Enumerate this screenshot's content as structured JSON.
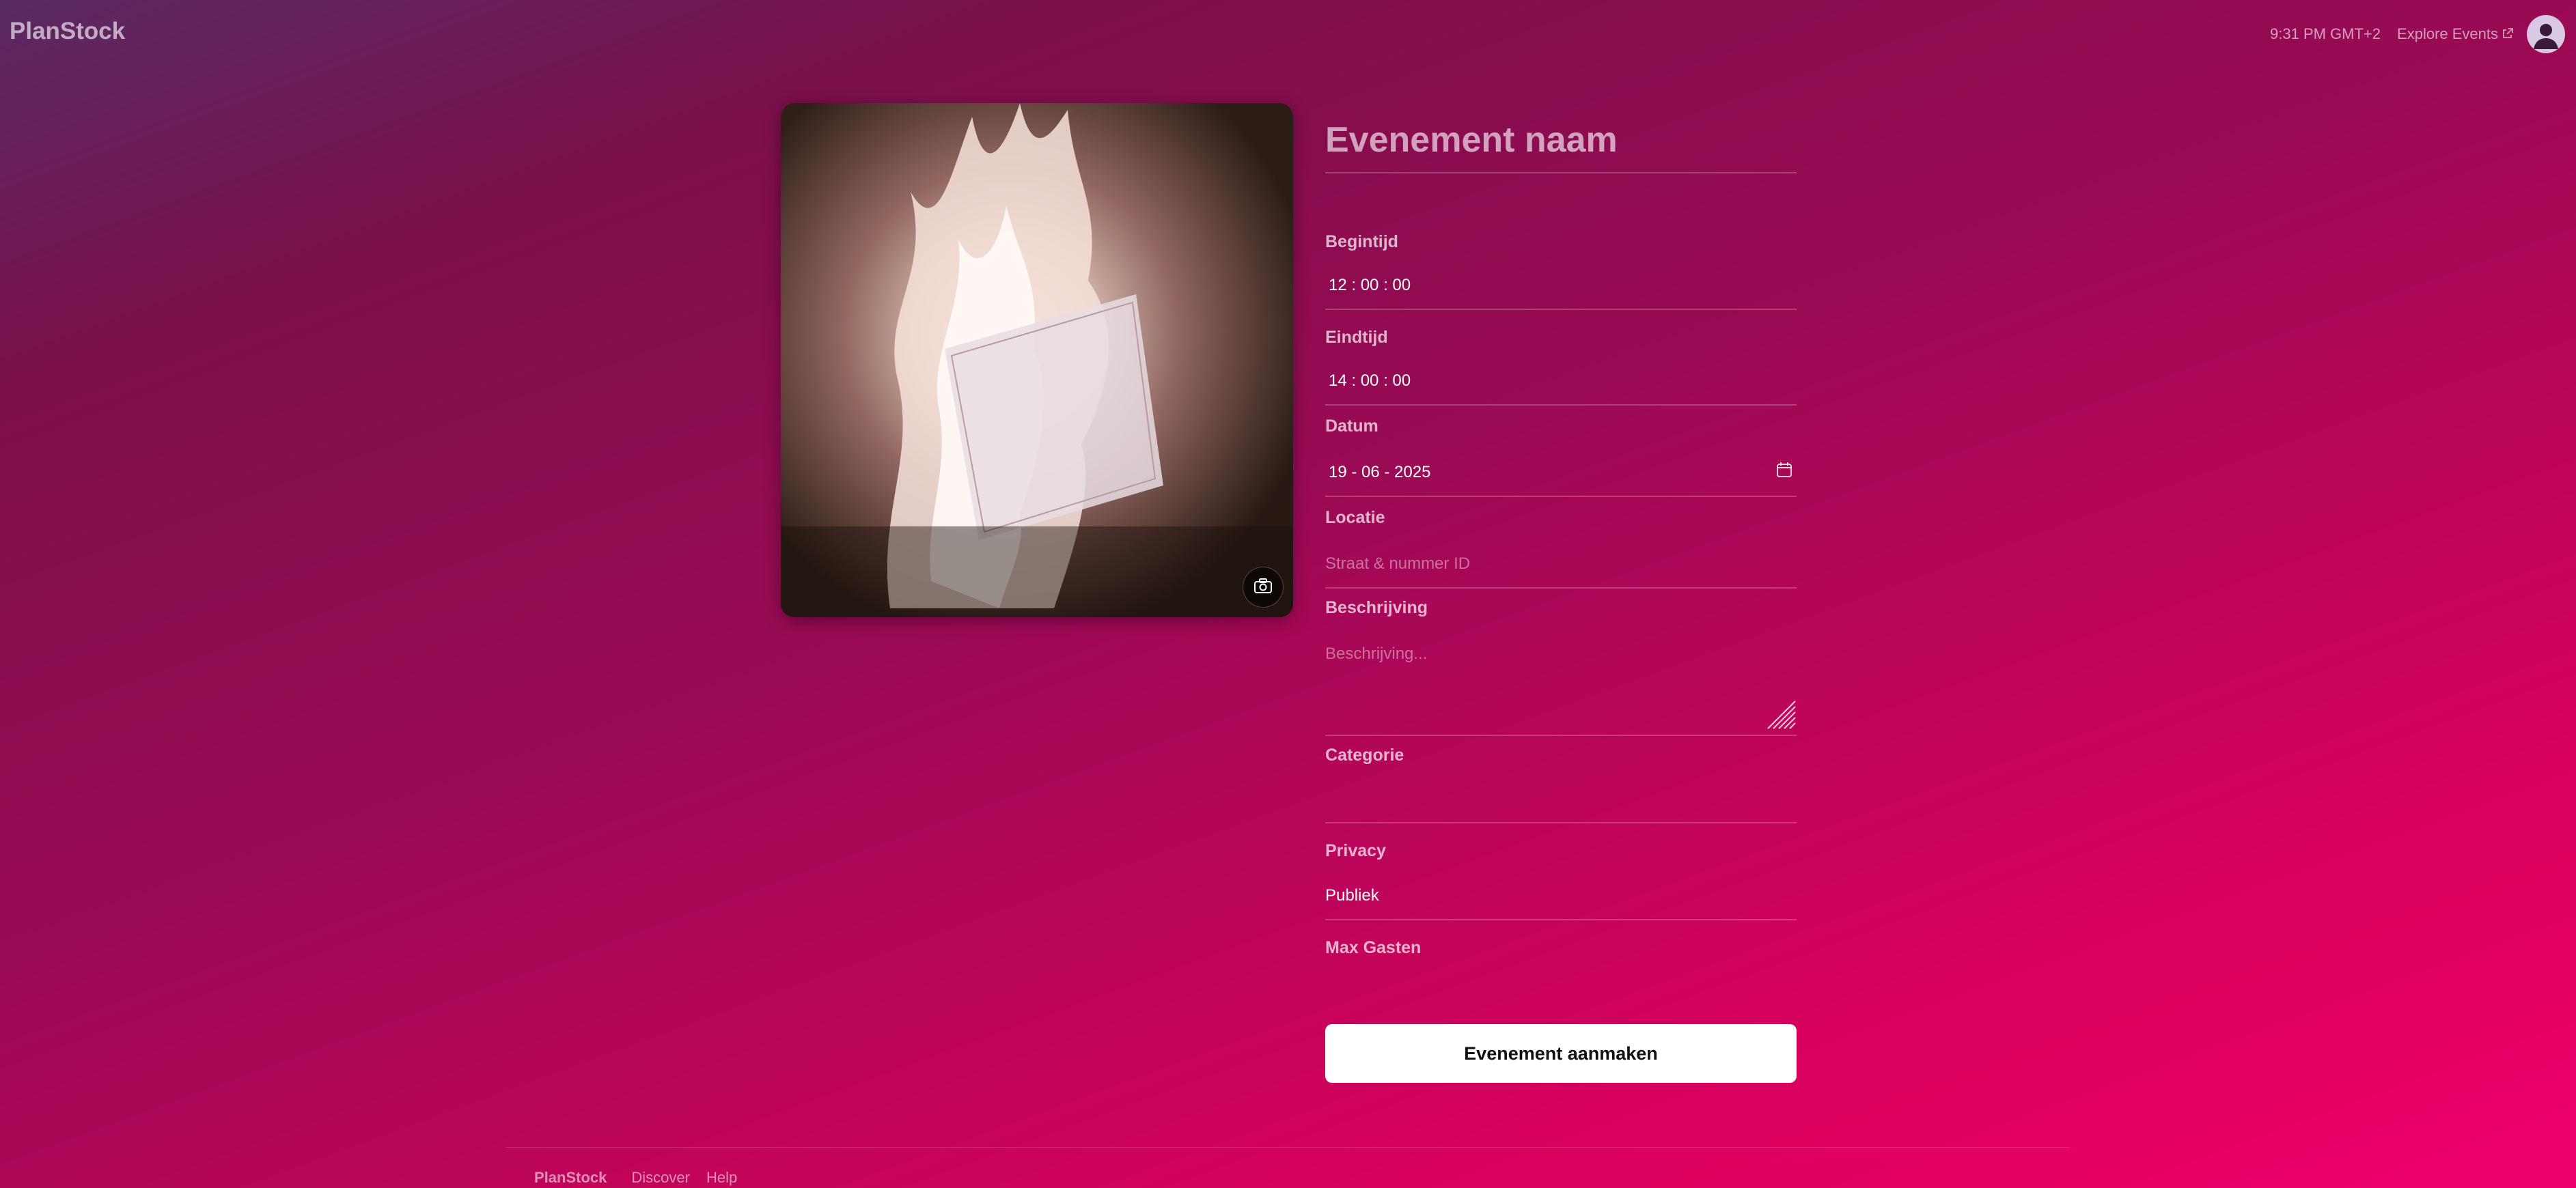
{
  "header": {
    "brand": "PlanStock",
    "clock": "9:31 PM GMT+2",
    "explore_label": "Explore Events",
    "avatar_icon": "user-avatar-icon"
  },
  "image": {
    "alt": "Burning book in flames",
    "camera_icon": "camera-icon"
  },
  "form": {
    "title_placeholder": "Evenement naam",
    "start_label": "Begintijd",
    "start_value": "12 : 00 : 00",
    "end_label": "Eindtijd",
    "end_value": "14 : 00 : 00",
    "date_label": "Datum",
    "date_value": "19 - 06 - 2025",
    "location_label": "Locatie",
    "location_placeholder": "Straat & nummer ID",
    "description_label": "Beschrijving",
    "description_placeholder": "Beschrijving...",
    "category_label": "Categorie",
    "category_value": "",
    "privacy_label": "Privacy",
    "privacy_value": "Publiek",
    "max_guests_label": "Max Gasten",
    "max_guests_value": "",
    "submit_label": "Evenement aanmaken"
  },
  "footer": {
    "brand": "PlanStock",
    "links": [
      "Discover",
      "Help"
    ]
  },
  "colors": {
    "gradient_start": "#5a2a64",
    "gradient_mid": "#9a0a55",
    "gradient_end": "#f0006c",
    "button_bg": "#ffffff"
  }
}
